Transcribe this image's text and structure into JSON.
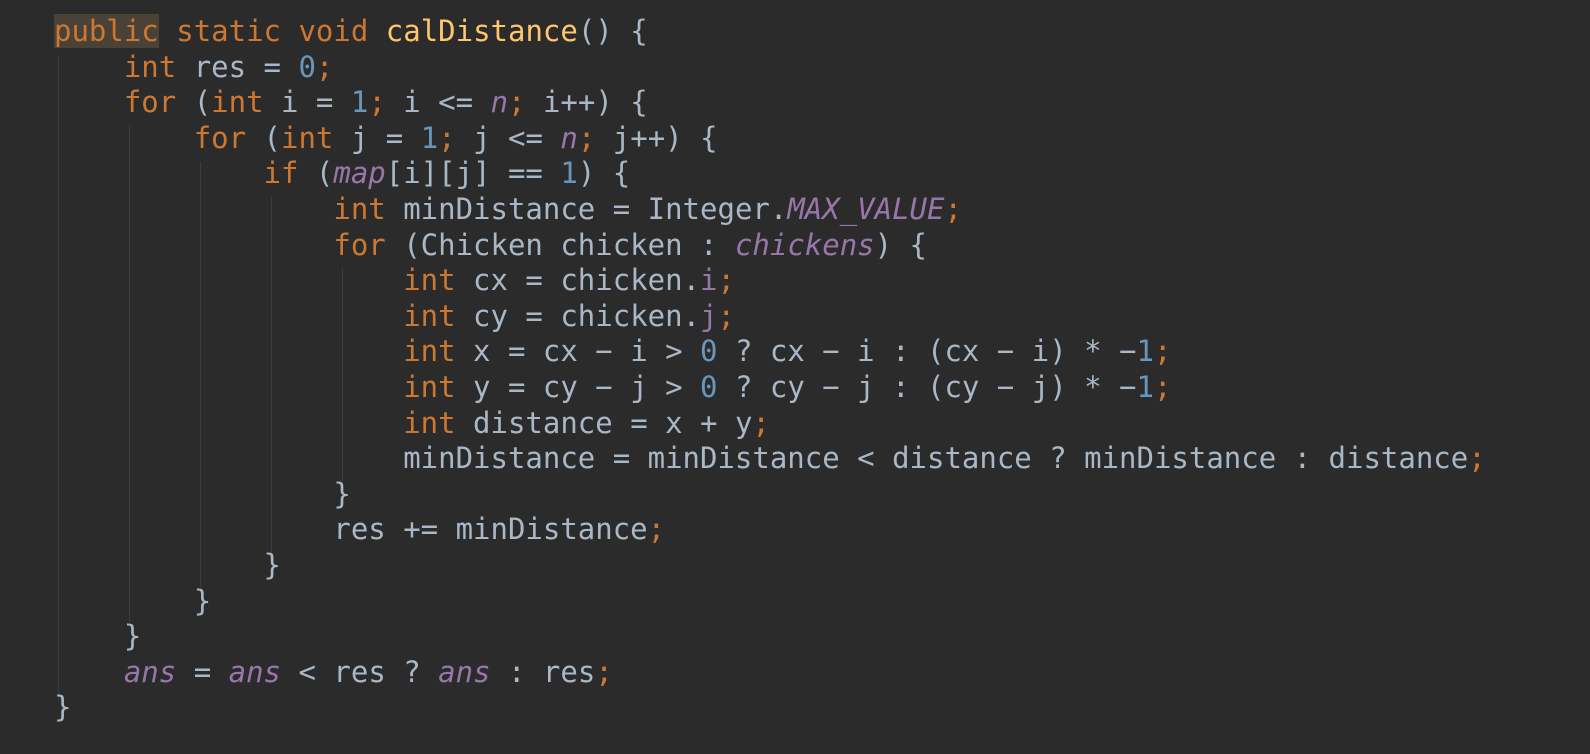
{
  "editor": {
    "background": "#2b2b2b",
    "colors": {
      "keyword": "#cc7832",
      "function": "#ffc66d",
      "number": "#6897bb",
      "field": "#9876aa",
      "text": "#a9b7c6"
    },
    "lines": [
      {
        "indent": 0,
        "tokens": [
          {
            "t": "public",
            "c": "kw hl"
          },
          {
            "t": " ",
            "c": "txt"
          },
          {
            "t": "static",
            "c": "kw"
          },
          {
            "t": " ",
            "c": "txt"
          },
          {
            "t": "void",
            "c": "kw"
          },
          {
            "t": " ",
            "c": "txt"
          },
          {
            "t": "calDistance",
            "c": "fn"
          },
          {
            "t": "() {",
            "c": "txt"
          }
        ]
      },
      {
        "indent": 1,
        "tokens": [
          {
            "t": "int",
            "c": "kw"
          },
          {
            "t": " res = ",
            "c": "txt"
          },
          {
            "t": "0",
            "c": "num"
          },
          {
            "t": ";",
            "c": "semi"
          }
        ]
      },
      {
        "indent": 1,
        "tokens": [
          {
            "t": "for",
            "c": "kw"
          },
          {
            "t": " (",
            "c": "txt"
          },
          {
            "t": "int",
            "c": "kw"
          },
          {
            "t": " i = ",
            "c": "txt"
          },
          {
            "t": "1",
            "c": "num"
          },
          {
            "t": ";",
            "c": "semi"
          },
          {
            "t": " i <= ",
            "c": "txt"
          },
          {
            "t": "n",
            "c": "fld"
          },
          {
            "t": ";",
            "c": "semi"
          },
          {
            "t": " i++) {",
            "c": "txt"
          }
        ]
      },
      {
        "indent": 2,
        "tokens": [
          {
            "t": "for",
            "c": "kw"
          },
          {
            "t": " (",
            "c": "txt"
          },
          {
            "t": "int",
            "c": "kw"
          },
          {
            "t": " j = ",
            "c": "txt"
          },
          {
            "t": "1",
            "c": "num"
          },
          {
            "t": ";",
            "c": "semi"
          },
          {
            "t": " j <= ",
            "c": "txt"
          },
          {
            "t": "n",
            "c": "fld"
          },
          {
            "t": ";",
            "c": "semi"
          },
          {
            "t": " j++) {",
            "c": "txt"
          }
        ]
      },
      {
        "indent": 3,
        "tokens": [
          {
            "t": "if",
            "c": "kw"
          },
          {
            "t": " (",
            "c": "txt"
          },
          {
            "t": "map",
            "c": "fld"
          },
          {
            "t": "[i][j] == ",
            "c": "txt"
          },
          {
            "t": "1",
            "c": "num"
          },
          {
            "t": ") {",
            "c": "txt"
          }
        ]
      },
      {
        "indent": 4,
        "tokens": [
          {
            "t": "int",
            "c": "kw"
          },
          {
            "t": " minDistance = Integer.",
            "c": "txt"
          },
          {
            "t": "MAX_VALUE",
            "c": "cst"
          },
          {
            "t": ";",
            "c": "semi"
          }
        ]
      },
      {
        "indent": 4,
        "tokens": [
          {
            "t": "for",
            "c": "kw"
          },
          {
            "t": " (Chicken chicken : ",
            "c": "txt"
          },
          {
            "t": "chickens",
            "c": "fld"
          },
          {
            "t": ") {",
            "c": "txt"
          }
        ]
      },
      {
        "indent": 5,
        "tokens": [
          {
            "t": "int",
            "c": "kw"
          },
          {
            "t": " cx = chicken.",
            "c": "txt"
          },
          {
            "t": "i",
            "c": "ifld"
          },
          {
            "t": ";",
            "c": "semi"
          }
        ]
      },
      {
        "indent": 5,
        "tokens": [
          {
            "t": "int",
            "c": "kw"
          },
          {
            "t": " cy = chicken.",
            "c": "txt"
          },
          {
            "t": "j",
            "c": "ifld"
          },
          {
            "t": ";",
            "c": "semi"
          }
        ]
      },
      {
        "indent": 5,
        "tokens": [
          {
            "t": "int",
            "c": "kw"
          },
          {
            "t": " x = cx − i > ",
            "c": "txt"
          },
          {
            "t": "0",
            "c": "num"
          },
          {
            "t": " ? cx − i : (cx − i) * −",
            "c": "txt"
          },
          {
            "t": "1",
            "c": "num"
          },
          {
            "t": ";",
            "c": "semi"
          }
        ]
      },
      {
        "indent": 5,
        "tokens": [
          {
            "t": "int",
            "c": "kw"
          },
          {
            "t": " y = cy − j > ",
            "c": "txt"
          },
          {
            "t": "0",
            "c": "num"
          },
          {
            "t": " ? cy − j : (cy − j) * −",
            "c": "txt"
          },
          {
            "t": "1",
            "c": "num"
          },
          {
            "t": ";",
            "c": "semi"
          }
        ]
      },
      {
        "indent": 5,
        "tokens": [
          {
            "t": "int",
            "c": "kw"
          },
          {
            "t": " distance = x + y",
            "c": "txt"
          },
          {
            "t": ";",
            "c": "semi"
          }
        ]
      },
      {
        "indent": 5,
        "tokens": [
          {
            "t": "minDistance = minDistance < distance ? minDistance : distance",
            "c": "txt"
          },
          {
            "t": ";",
            "c": "semi"
          }
        ]
      },
      {
        "indent": 4,
        "tokens": [
          {
            "t": "}",
            "c": "txt"
          }
        ]
      },
      {
        "indent": 4,
        "tokens": [
          {
            "t": "res += minDistance",
            "c": "txt"
          },
          {
            "t": ";",
            "c": "semi"
          }
        ]
      },
      {
        "indent": 3,
        "tokens": [
          {
            "t": "}",
            "c": "txt"
          }
        ]
      },
      {
        "indent": 2,
        "tokens": [
          {
            "t": "}",
            "c": "txt"
          }
        ]
      },
      {
        "indent": 1,
        "tokens": [
          {
            "t": "}",
            "c": "txt"
          }
        ]
      },
      {
        "indent": 1,
        "tokens": [
          {
            "t": "ans",
            "c": "fld"
          },
          {
            "t": " = ",
            "c": "txt"
          },
          {
            "t": "ans",
            "c": "fld"
          },
          {
            "t": " < res ? ",
            "c": "txt"
          },
          {
            "t": "ans",
            "c": "fld"
          },
          {
            "t": " : res",
            "c": "txt"
          },
          {
            "t": ";",
            "c": "semi"
          }
        ]
      },
      {
        "indent": 0,
        "tokens": [
          {
            "t": "}",
            "c": "txt"
          }
        ]
      }
    ]
  }
}
